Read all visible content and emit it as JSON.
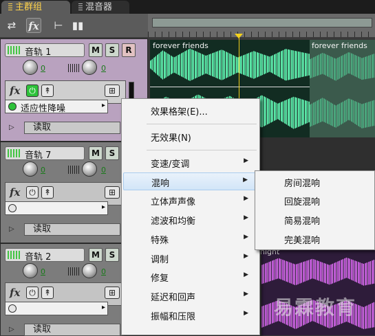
{
  "tabs": [
    {
      "label": "主群组",
      "active": true
    },
    {
      "label": "混音器",
      "active": false
    }
  ],
  "toolbar": {
    "fx_label": "fx"
  },
  "tracks": [
    {
      "name": "音轨 1",
      "m": "M",
      "s": "S",
      "r": "R",
      "vol": "0",
      "pan": "0",
      "fx_label": "fx",
      "effect": "适应性降噪",
      "read": "读取"
    },
    {
      "name": "音轨 7",
      "m": "M",
      "s": "S",
      "vol": "0",
      "pan": "0",
      "fx_label": "fx",
      "effect": "",
      "read": "读取"
    },
    {
      "name": "音轨 2",
      "m": "M",
      "s": "S",
      "vol": "0",
      "pan": "0",
      "fx_label": "fx",
      "effect": "",
      "read": "读取"
    }
  ],
  "clips": {
    "clip1_label": "forever friends",
    "clip2_label": "forever friends",
    "clip3_label": "night",
    "watermark": "易霖教育"
  },
  "menu": {
    "items": [
      {
        "label": "效果格架(E)...",
        "submenu": false
      },
      {
        "label": "无效果(N)",
        "submenu": false
      },
      {
        "label": "变速/变调",
        "submenu": true
      },
      {
        "label": "混响",
        "submenu": true,
        "highlighted": true
      },
      {
        "label": "立体声声像",
        "submenu": true
      },
      {
        "label": "滤波和均衡",
        "submenu": true
      },
      {
        "label": "特殊",
        "submenu": true
      },
      {
        "label": "调制",
        "submenu": true
      },
      {
        "label": "修复",
        "submenu": true
      },
      {
        "label": "延迟和回声",
        "submenu": true
      },
      {
        "label": "振幅和压限",
        "submenu": true
      }
    ]
  },
  "submenu": {
    "items": [
      {
        "label": "房间混响"
      },
      {
        "label": "回旋混响"
      },
      {
        "label": "简易混响"
      },
      {
        "label": "完美混响"
      }
    ]
  },
  "colors": {
    "accent": "#ffd34a",
    "power_on": "#2ec23a",
    "wave_green": "#5fe8a8",
    "wave_purple": "#c05dd6"
  }
}
